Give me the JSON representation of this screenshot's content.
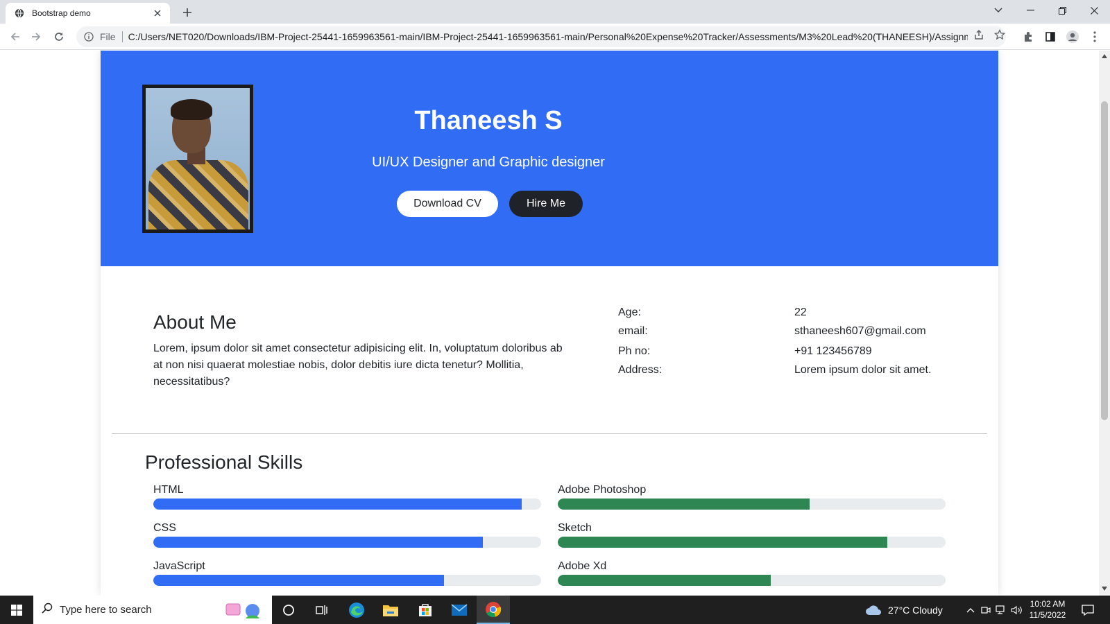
{
  "browser": {
    "tab_title": "Bootstrap demo",
    "file_label": "File",
    "url": "C:/Users/NET020/Downloads/IBM-Project-25441-1659963561-main/IBM-Project-25441-1659963561-main/Personal%20Expense%20Tracker/Assessments/M3%20Lead%20(THANEESH)/Assignme..."
  },
  "hero": {
    "name": "Thaneesh S",
    "title": "UI/UX Designer and Graphic designer",
    "download_label": "Download CV",
    "hire_label": "Hire Me",
    "bg_color": "#316cf4"
  },
  "about": {
    "heading": "About Me",
    "text": "Lorem, ipsum dolor sit amet consectetur adipisicing elit. In, voluptatum doloribus ab at non nisi quaerat molestiae nobis, dolor debitis iure dicta tenetur? Mollitia, necessitatibus?",
    "info": [
      {
        "label": "Age:",
        "value": "22"
      },
      {
        "label": "email:",
        "value": "sthaneesh607@gmail.com"
      },
      {
        "label": "Ph no:",
        "value": "+91 123456789"
      },
      {
        "label": "Address:",
        "value": "Lorem ipsum dolor sit amet."
      }
    ]
  },
  "skills": {
    "heading": "Professional Skills",
    "left": [
      {
        "name": "HTML",
        "level": 0.95
      },
      {
        "name": "CSS",
        "level": 0.85
      },
      {
        "name": "JavaScript",
        "level": 0.75
      }
    ],
    "right": [
      {
        "name": "Adobe Photoshop",
        "level": 0.65
      },
      {
        "name": "Sketch",
        "level": 0.85
      },
      {
        "name": "Adobe Xd",
        "level": 0.55
      }
    ],
    "left_color": "#316cf4",
    "right_color": "#2e8752"
  },
  "taskbar": {
    "search_placeholder": "Type here to search",
    "weather": "27°C  Cloudy",
    "time": "10:02 AM",
    "date": "11/5/2022"
  }
}
